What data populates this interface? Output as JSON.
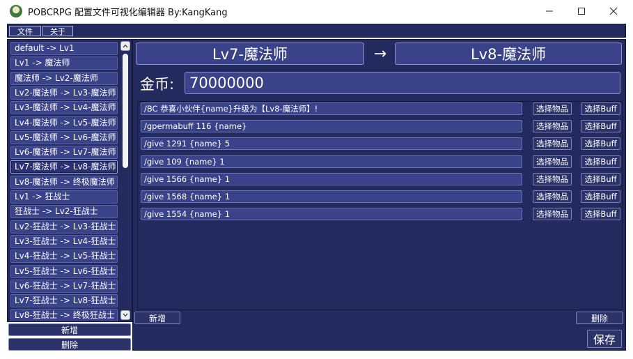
{
  "window": {
    "title": "POBCRPG 配置文件可视化编辑器 By:KangKang"
  },
  "menu": {
    "file": "文件",
    "about": "关于"
  },
  "level_list": {
    "items": [
      "default -> Lv1",
      "Lv1 -> 魔法师",
      "魔法师 -> Lv2-魔法师",
      "Lv2-魔法师 -> Lv3-魔法师",
      "Lv3-魔法师 -> Lv4-魔法师",
      "Lv4-魔法师 -> Lv5-魔法师",
      "Lv5-魔法师 -> Lv6-魔法师",
      "Lv6-魔法师 -> Lv7-魔法师",
      "Lv7-魔法师 -> Lv8-魔法师",
      "Lv8-魔法师 -> 终极魔法师",
      "Lv1 -> 狂战士",
      "狂战士 -> Lv2-狂战士",
      "Lv2-狂战士 -> Lv3-狂战士",
      "Lv3-狂战士 -> Lv4-狂战士",
      "Lv4-狂战士 -> Lv5-狂战士",
      "Lv5-狂战士 -> Lv6-狂战士",
      "Lv6-狂战士 -> Lv7-狂战士",
      "Lv7-狂战士 -> Lv8-狂战士",
      "Lv8-狂战士 -> 终极狂战士"
    ],
    "selected_index": 8,
    "add_label": "新增",
    "delete_label": "删除"
  },
  "editor": {
    "from_level": "Lv7-魔法师",
    "arrow": "→",
    "to_level": "Lv8-魔法师",
    "coin_label": "金币:",
    "coin_value": "70000000",
    "commands": [
      "/BC 恭喜小伙伴{name}升级为【Lv8-魔法师】!",
      "/gpermabuff 116 {name}",
      "/give 1291 {name} 5",
      "/give 109 {name} 1",
      "/give 1566 {name} 1",
      "/give 1568 {name} 1",
      "/give 1554 {name} 1"
    ],
    "select_item_label": "选择物品",
    "select_buff_label": "选择Buff",
    "add_label": "新增",
    "delete_label": "删除",
    "save_label": "保存"
  }
}
